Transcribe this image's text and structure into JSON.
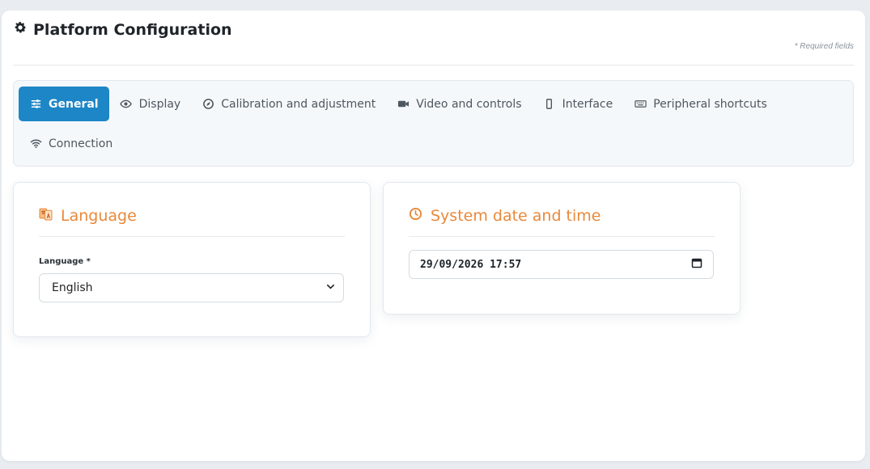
{
  "page": {
    "title": "Platform Configuration",
    "required_note": "* Required fields"
  },
  "tabs": [
    {
      "label": "General",
      "icon": "sliders-icon",
      "active": true
    },
    {
      "label": "Display",
      "icon": "eye-icon",
      "active": false
    },
    {
      "label": "Calibration and adjustment",
      "icon": "compass-icon",
      "active": false
    },
    {
      "label": "Video and controls",
      "icon": "video-camera-icon",
      "active": false
    },
    {
      "label": "Interface",
      "icon": "mobile-icon",
      "active": false
    },
    {
      "label": "Peripheral shortcuts",
      "icon": "keyboard-icon",
      "active": false
    },
    {
      "label": "Connection",
      "icon": "wifi-icon",
      "active": false
    }
  ],
  "language_card": {
    "title": "Language",
    "icon": "language-icon",
    "field_label": "Language *",
    "selected_value": "English"
  },
  "datetime_card": {
    "title": "System date and time",
    "icon": "clock-icon",
    "value": "29/09/2026 17:57"
  },
  "colors": {
    "accent": "#1d86c7",
    "card_title": "#e8893a"
  }
}
